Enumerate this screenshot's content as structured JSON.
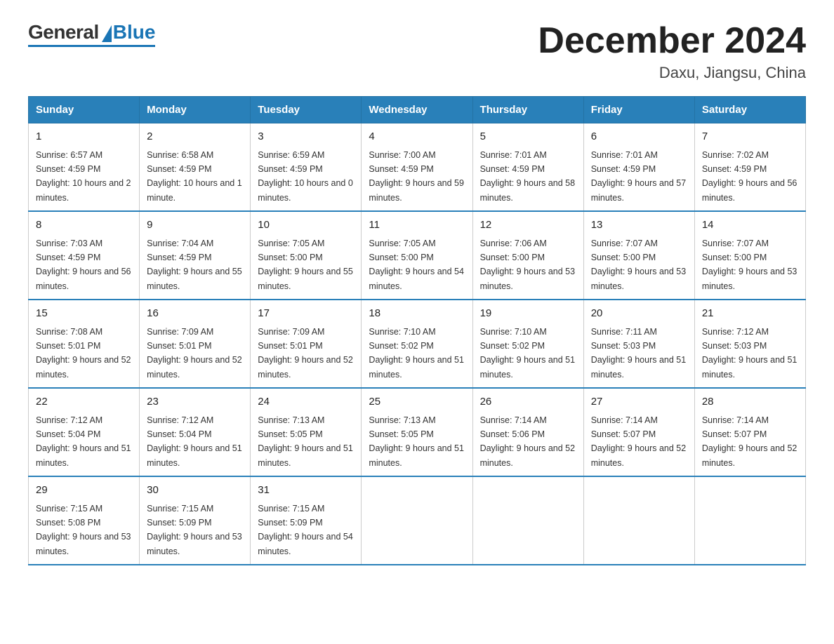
{
  "header": {
    "title": "December 2024",
    "subtitle": "Daxu, Jiangsu, China"
  },
  "logo": {
    "general": "General",
    "blue": "Blue"
  },
  "days_of_week": [
    "Sunday",
    "Monday",
    "Tuesday",
    "Wednesday",
    "Thursday",
    "Friday",
    "Saturday"
  ],
  "weeks": [
    [
      {
        "day": "1",
        "sunrise": "6:57 AM",
        "sunset": "4:59 PM",
        "daylight": "10 hours and 2 minutes."
      },
      {
        "day": "2",
        "sunrise": "6:58 AM",
        "sunset": "4:59 PM",
        "daylight": "10 hours and 1 minute."
      },
      {
        "day": "3",
        "sunrise": "6:59 AM",
        "sunset": "4:59 PM",
        "daylight": "10 hours and 0 minutes."
      },
      {
        "day": "4",
        "sunrise": "7:00 AM",
        "sunset": "4:59 PM",
        "daylight": "9 hours and 59 minutes."
      },
      {
        "day": "5",
        "sunrise": "7:01 AM",
        "sunset": "4:59 PM",
        "daylight": "9 hours and 58 minutes."
      },
      {
        "day": "6",
        "sunrise": "7:01 AM",
        "sunset": "4:59 PM",
        "daylight": "9 hours and 57 minutes."
      },
      {
        "day": "7",
        "sunrise": "7:02 AM",
        "sunset": "4:59 PM",
        "daylight": "9 hours and 56 minutes."
      }
    ],
    [
      {
        "day": "8",
        "sunrise": "7:03 AM",
        "sunset": "4:59 PM",
        "daylight": "9 hours and 56 minutes."
      },
      {
        "day": "9",
        "sunrise": "7:04 AM",
        "sunset": "4:59 PM",
        "daylight": "9 hours and 55 minutes."
      },
      {
        "day": "10",
        "sunrise": "7:05 AM",
        "sunset": "5:00 PM",
        "daylight": "9 hours and 55 minutes."
      },
      {
        "day": "11",
        "sunrise": "7:05 AM",
        "sunset": "5:00 PM",
        "daylight": "9 hours and 54 minutes."
      },
      {
        "day": "12",
        "sunrise": "7:06 AM",
        "sunset": "5:00 PM",
        "daylight": "9 hours and 53 minutes."
      },
      {
        "day": "13",
        "sunrise": "7:07 AM",
        "sunset": "5:00 PM",
        "daylight": "9 hours and 53 minutes."
      },
      {
        "day": "14",
        "sunrise": "7:07 AM",
        "sunset": "5:00 PM",
        "daylight": "9 hours and 53 minutes."
      }
    ],
    [
      {
        "day": "15",
        "sunrise": "7:08 AM",
        "sunset": "5:01 PM",
        "daylight": "9 hours and 52 minutes."
      },
      {
        "day": "16",
        "sunrise": "7:09 AM",
        "sunset": "5:01 PM",
        "daylight": "9 hours and 52 minutes."
      },
      {
        "day": "17",
        "sunrise": "7:09 AM",
        "sunset": "5:01 PM",
        "daylight": "9 hours and 52 minutes."
      },
      {
        "day": "18",
        "sunrise": "7:10 AM",
        "sunset": "5:02 PM",
        "daylight": "9 hours and 51 minutes."
      },
      {
        "day": "19",
        "sunrise": "7:10 AM",
        "sunset": "5:02 PM",
        "daylight": "9 hours and 51 minutes."
      },
      {
        "day": "20",
        "sunrise": "7:11 AM",
        "sunset": "5:03 PM",
        "daylight": "9 hours and 51 minutes."
      },
      {
        "day": "21",
        "sunrise": "7:12 AM",
        "sunset": "5:03 PM",
        "daylight": "9 hours and 51 minutes."
      }
    ],
    [
      {
        "day": "22",
        "sunrise": "7:12 AM",
        "sunset": "5:04 PM",
        "daylight": "9 hours and 51 minutes."
      },
      {
        "day": "23",
        "sunrise": "7:12 AM",
        "sunset": "5:04 PM",
        "daylight": "9 hours and 51 minutes."
      },
      {
        "day": "24",
        "sunrise": "7:13 AM",
        "sunset": "5:05 PM",
        "daylight": "9 hours and 51 minutes."
      },
      {
        "day": "25",
        "sunrise": "7:13 AM",
        "sunset": "5:05 PM",
        "daylight": "9 hours and 51 minutes."
      },
      {
        "day": "26",
        "sunrise": "7:14 AM",
        "sunset": "5:06 PM",
        "daylight": "9 hours and 52 minutes."
      },
      {
        "day": "27",
        "sunrise": "7:14 AM",
        "sunset": "5:07 PM",
        "daylight": "9 hours and 52 minutes."
      },
      {
        "day": "28",
        "sunrise": "7:14 AM",
        "sunset": "5:07 PM",
        "daylight": "9 hours and 52 minutes."
      }
    ],
    [
      {
        "day": "29",
        "sunrise": "7:15 AM",
        "sunset": "5:08 PM",
        "daylight": "9 hours and 53 minutes."
      },
      {
        "day": "30",
        "sunrise": "7:15 AM",
        "sunset": "5:09 PM",
        "daylight": "9 hours and 53 minutes."
      },
      {
        "day": "31",
        "sunrise": "7:15 AM",
        "sunset": "5:09 PM",
        "daylight": "9 hours and 54 minutes."
      },
      null,
      null,
      null,
      null
    ]
  ]
}
